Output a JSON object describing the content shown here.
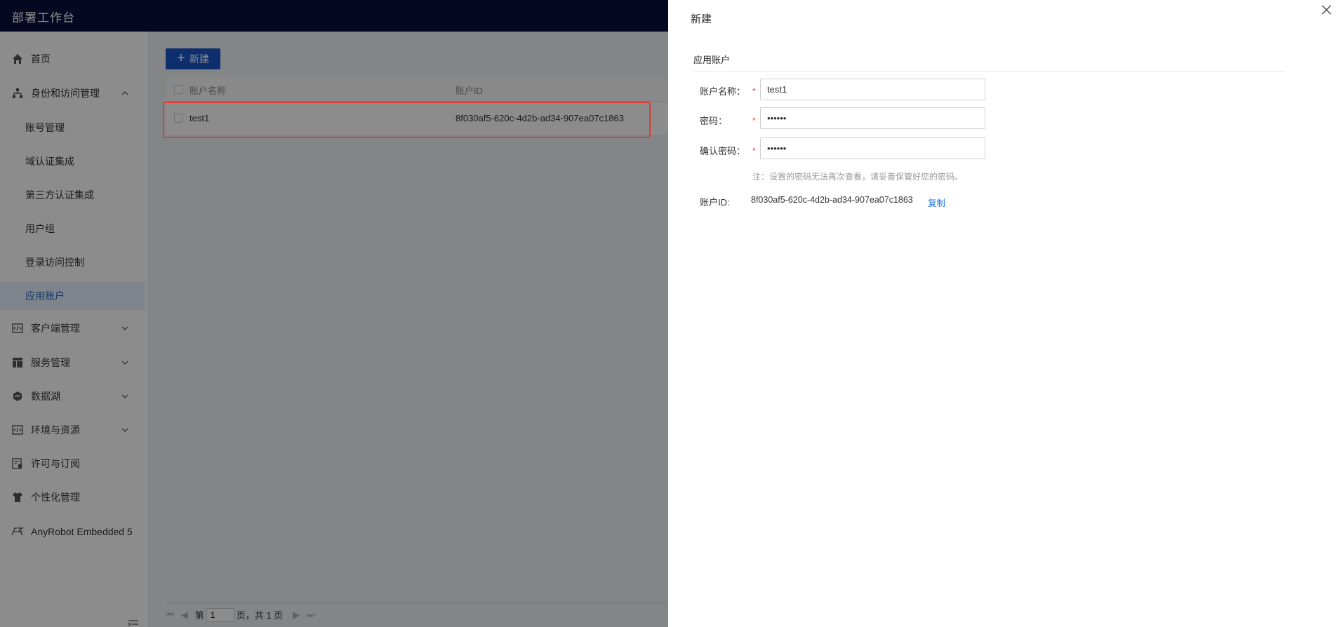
{
  "app": {
    "title": "部署工作台"
  },
  "sidebar": {
    "items": [
      {
        "label": "首页",
        "icon": "home-icon"
      },
      {
        "label": "身份和访问管理",
        "icon": "org-icon",
        "expanded": true
      },
      {
        "label": "客户端管理",
        "icon": "code-window-icon"
      },
      {
        "label": "服务管理",
        "icon": "layout-icon"
      },
      {
        "label": "数据湖",
        "icon": "datalake-icon"
      },
      {
        "label": "环境与资源",
        "icon": "code-window-icon"
      },
      {
        "label": "许可与订阅",
        "icon": "license-icon"
      },
      {
        "label": "个性化管理",
        "icon": "shirt-icon"
      },
      {
        "label": "AnyRobot Embedded 5",
        "icon": "anyrobot-icon"
      }
    ],
    "subitems": [
      {
        "label": "账号管理"
      },
      {
        "label": "域认证集成"
      },
      {
        "label": "第三方认证集成"
      },
      {
        "label": "用户组"
      },
      {
        "label": "登录访问控制"
      },
      {
        "label": "应用账户",
        "active": true
      }
    ]
  },
  "main": {
    "new_button": "新建",
    "table": {
      "columns": [
        "账户名称",
        "账户ID"
      ],
      "rows": [
        {
          "name": "test1",
          "id": "8f030af5-620c-4d2b-ad34-907ea07c1863"
        }
      ]
    },
    "pager": {
      "prefix": "第",
      "page": "1",
      "suffix": "页，共 1 页"
    }
  },
  "drawer": {
    "title": "新建",
    "section": "应用账户",
    "fields": {
      "account_name": {
        "label": "账户名称：",
        "value": "test1"
      },
      "password": {
        "label": "密码：",
        "value": "••••••"
      },
      "confirm_password": {
        "label": "确认密码：",
        "value": "••••••"
      }
    },
    "required_mark": "*",
    "hint": "注：设置的密码无法再次查看，请妥善保管好您的密码。",
    "account_id": {
      "label": "账户ID:",
      "value": "8f030af5-620c-4d2b-ad34-907ea07c1863",
      "copy": "复制"
    }
  },
  "colors": {
    "topbar": "#0b0f3f",
    "primary": "#1a57c6",
    "highlight": "#e53935",
    "link": "#1a73e8"
  }
}
